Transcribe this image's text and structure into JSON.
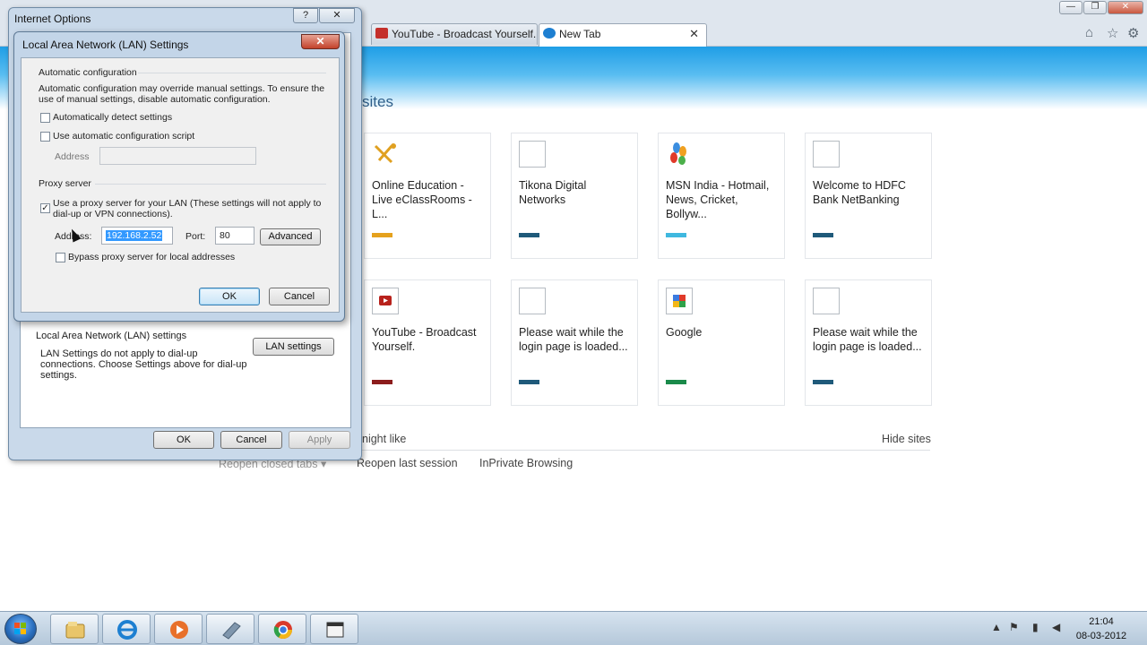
{
  "browser": {
    "tabs": [
      {
        "label": "YouTube - Broadcast Yourself.",
        "favicon_color": "#c4302b"
      },
      {
        "label": "New Tab",
        "favicon_color": "#1d7fd1",
        "close": "✕"
      }
    ],
    "window_controls": {
      "minimize": "—",
      "restore": "❐",
      "close": "✕"
    },
    "toolbar_icons": {
      "home": "⌂",
      "favorites": "☆",
      "tools": "⚙"
    },
    "accent_color": "#1f9ee6"
  },
  "new_tab_page": {
    "heading": "sites",
    "tiles": [
      {
        "title": "Online Education - Live eClassRooms - L...",
        "bar_color": "#e5a11d",
        "icon": "education-logo-icon"
      },
      {
        "title": "Tikona Digital Networks",
        "bar_color": "#1f5a7a",
        "icon": "blank-page-icon"
      },
      {
        "title": "MSN India - Hotmail, News, Cricket, Bollyw...",
        "bar_color": "#3fb8df",
        "icon": "msn-butterfly-icon"
      },
      {
        "title": "Welcome to HDFC Bank NetBanking",
        "bar_color": "#1f5a7a",
        "icon": "blank-page-icon"
      },
      {
        "title": "YouTube - Broadcast Yourself.",
        "bar_color": "#8c1c1c",
        "icon": "youtube-icon"
      },
      {
        "title": "Please wait while the login page is loaded...",
        "bar_color": "#1f5a7a",
        "icon": "blank-page-icon"
      },
      {
        "title": "Google",
        "bar_color": "#1a8a4a",
        "icon": "google-icon"
      },
      {
        "title": "Please wait while the login page is loaded...",
        "bar_color": "#1f5a7a",
        "icon": "blank-page-icon"
      }
    ],
    "might_like": "night like",
    "hide_sites": "Hide sites",
    "reopen_closed_tabs": "Reopen closed tabs ▾",
    "reopen_last_session": "Reopen last session",
    "inprivate": "InPrivate Browsing"
  },
  "internet_options": {
    "title": "Internet Options",
    "help": "?",
    "close": "✕",
    "lan_group_label": "Local Area Network (LAN) settings",
    "lan_desc": "LAN Settings do not apply to dial-up connections. Choose Settings above for dial-up settings.",
    "lan_settings_button": "LAN settings",
    "ok": "OK",
    "cancel": "Cancel",
    "apply": "Apply"
  },
  "lan_settings": {
    "title": "Local Area Network (LAN) Settings",
    "close": "✕",
    "auto_config_label": "Automatic configuration",
    "auto_config_desc": "Automatic configuration may override manual settings.  To ensure the use of manual settings, disable automatic configuration.",
    "auto_detect": {
      "label": "Automatically detect settings",
      "checked": false
    },
    "auto_script": {
      "label": "Use automatic configuration script",
      "checked": false
    },
    "script_address_label": "Address",
    "script_address_value": "",
    "proxy_label": "Proxy server",
    "use_proxy": {
      "label": "Use a proxy server for your LAN (These settings will not apply to dial-up or VPN connections).",
      "checked": true,
      "mark": "✓"
    },
    "proxy_address_label": "Address:",
    "proxy_address_value": "192.168.2.52",
    "port_label": "Port:",
    "port_value": "80",
    "advanced_button": "Advanced",
    "bypass_local": {
      "label": "Bypass proxy server for local addresses",
      "checked": false
    },
    "ok": "OK",
    "cancel": "Cancel"
  },
  "taskbar": {
    "time": "21:04",
    "date": "08-03-2012",
    "pinned": [
      "explorer-icon",
      "internet-explorer-icon",
      "media-player-icon",
      "notepad-icon",
      "chrome-icon",
      "app-window-icon"
    ],
    "tray": {
      "show_hidden": "▲",
      "flag": "⚑",
      "network": "▮",
      "volume": "◀"
    }
  }
}
